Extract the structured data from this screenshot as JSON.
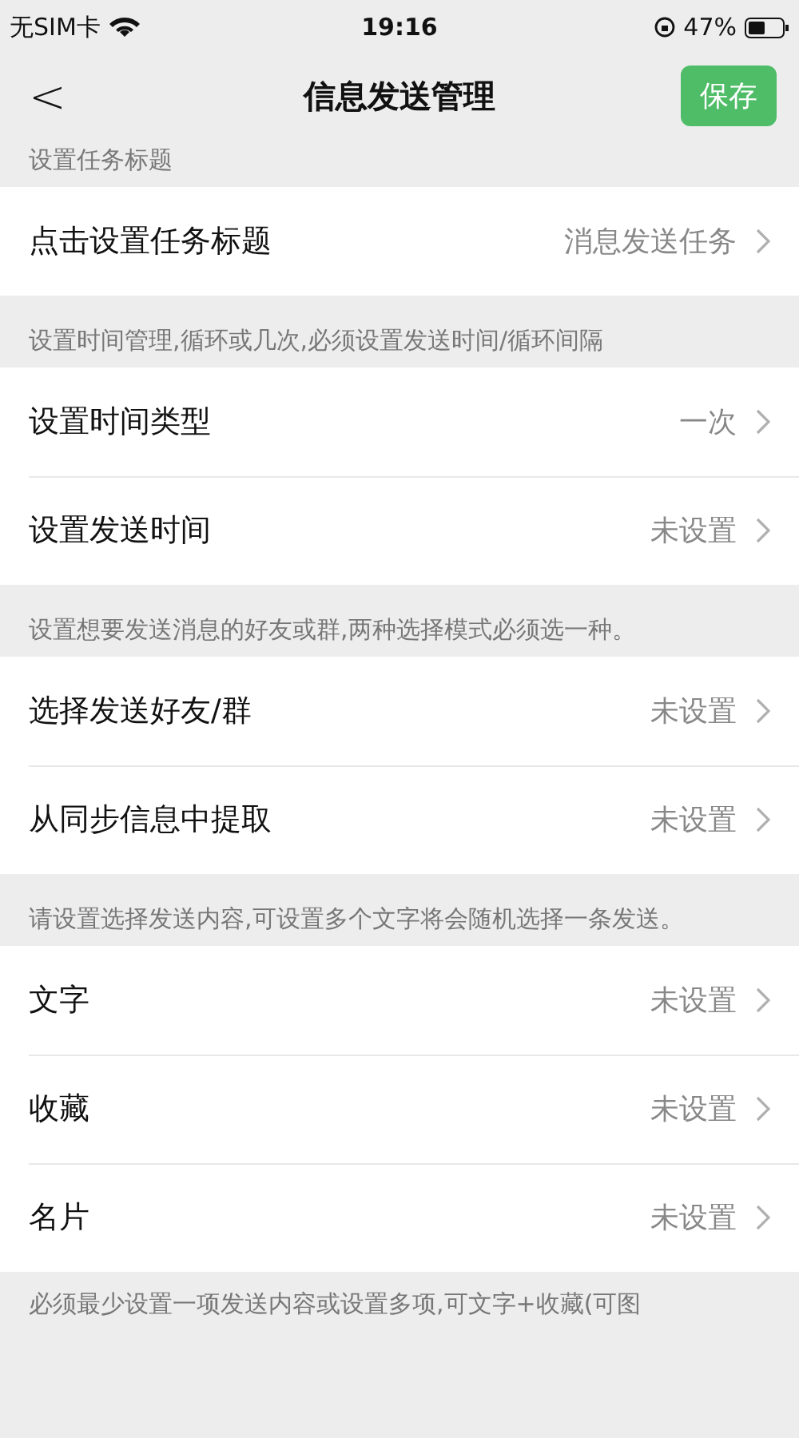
{
  "status_bar": {
    "carrier": "无SIM卡",
    "time": "19:16",
    "battery": "47%"
  },
  "nav": {
    "back": "<",
    "title": "信息发送管理",
    "save": "保存"
  },
  "sections": [
    {
      "note": "设置任务标题",
      "rows": [
        {
          "label": "点击设置任务标题",
          "value": "消息发送任务"
        }
      ]
    },
    {
      "note": "设置时间管理,循环或几次,必须设置发送时间/循环间隔",
      "rows": [
        {
          "label": "设置时间类型",
          "value": "一次"
        },
        {
          "label": "设置发送时间",
          "value": "未设置"
        }
      ]
    },
    {
      "note": "设置想要发送消息的好友或群,两种选择模式必须选一种。",
      "rows": [
        {
          "label": "选择发送好友/群",
          "value": "未设置"
        },
        {
          "label": "从同步信息中提取",
          "value": "未设置"
        }
      ]
    },
    {
      "note": "请设置选择发送内容,可设置多个文字将会随机选择一条发送。",
      "rows": [
        {
          "label": "文字",
          "value": "未设置"
        },
        {
          "label": "收藏",
          "value": "未设置"
        },
        {
          "label": "名片",
          "value": "未设置"
        }
      ]
    }
  ],
  "footer_note": "必须最少设置一项发送内容或设置多项,可文字+收藏(可图"
}
